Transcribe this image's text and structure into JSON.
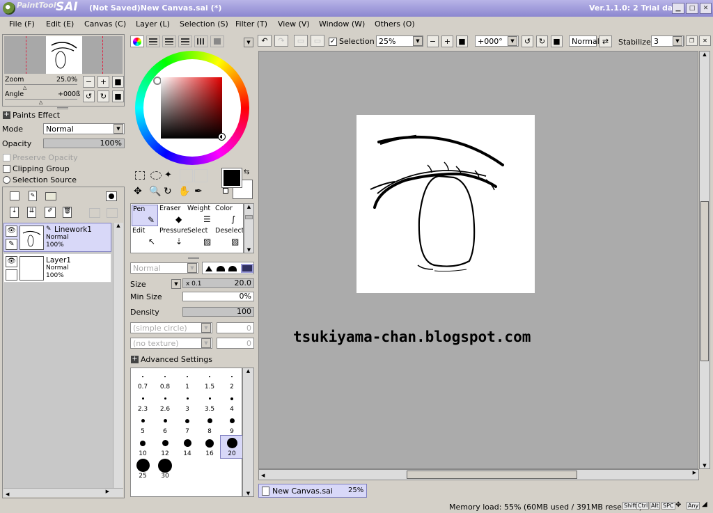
{
  "app": {
    "logo_small": "PaintTool",
    "logo_big": "SAI",
    "title": "(Not Saved)New Canvas.sai (*)",
    "version": "Ver.1.1.0: 2 Trial day"
  },
  "menu": [
    "File (F)",
    "Edit (E)",
    "Canvas (C)",
    "Layer (L)",
    "Selection (S)",
    "Filter (T)",
    "View (V)",
    "Window (W)",
    "Others (O)"
  ],
  "nav": {
    "zoom_label": "Zoom",
    "zoom_value": "25.0%",
    "angle_label": "Angle",
    "angle_value": "+000ß"
  },
  "effects": {
    "paints_effect": "Paints Effect",
    "mode_label": "Mode",
    "mode_value": "Normal",
    "opacity_label": "Opacity",
    "opacity_value": "100%",
    "opacity_level": 1.0,
    "preserve_opacity": "Preserve Opacity",
    "clipping_group": "Clipping Group",
    "selection_source": "Selection Source"
  },
  "layers": [
    {
      "name": "Linework1",
      "mode": "Normal",
      "opacity": "100%",
      "selected": true
    },
    {
      "name": "Layer1",
      "mode": "Normal",
      "opacity": "100%",
      "selected": false
    }
  ],
  "tools": [
    {
      "label": "Pen",
      "icon": "pen-icon"
    },
    {
      "label": "Eraser",
      "icon": "eraser-icon"
    },
    {
      "label": "Weight",
      "icon": "weight-icon"
    },
    {
      "label": "Color",
      "icon": "color-icon"
    },
    {
      "label": "Edit",
      "icon": "edit-icon"
    },
    {
      "label": "Pressure",
      "icon": "pressure-icon"
    },
    {
      "label": "Select",
      "icon": "select-icon"
    },
    {
      "label": "Deselect",
      "icon": "deselect-icon"
    }
  ],
  "brush": {
    "blend_mode": "Normal",
    "size_label": "Size",
    "size_multiplier": "x 0.1",
    "size_value": "20.0",
    "min_size_label": "Min Size",
    "min_size_value": "0%",
    "density_label": "Density",
    "density_value": "100",
    "shape": "(simple circle)",
    "shape_value": "0",
    "texture": "(no texture)",
    "texture_value": "0",
    "advanced": "Advanced Settings",
    "presets": [
      "0.7",
      "0.8",
      "1",
      "1.5",
      "2",
      "2.3",
      "2.6",
      "3",
      "3.5",
      "4",
      "5",
      "6",
      "7",
      "8",
      "9",
      "10",
      "12",
      "14",
      "16",
      "20",
      "25",
      "30"
    ],
    "selected_preset": "20"
  },
  "toolbar": {
    "selection_label": "Selection",
    "zoom": "25%",
    "angle": "+000°",
    "blend": "Normal",
    "stabilizer_label": "Stabilizer",
    "stabilizer_value": "3"
  },
  "canvas": {
    "watermark": "tsukiyama-chan.blogspot.com",
    "tab_name": "New Canvas.sai",
    "tab_zoom": "25%"
  },
  "status": {
    "memory": "Memory load: 55% (60MB used / 391MB reserved)",
    "keys": [
      "Shift",
      "Ctrl",
      "Alt",
      "SPC",
      "Any"
    ]
  },
  "colors": {
    "title_bar": "#9c98dc",
    "canvas_bg": "#ababab",
    "selected_layer": "#d8d8f8",
    "foreground": "#000000",
    "background": "#ffffff"
  }
}
